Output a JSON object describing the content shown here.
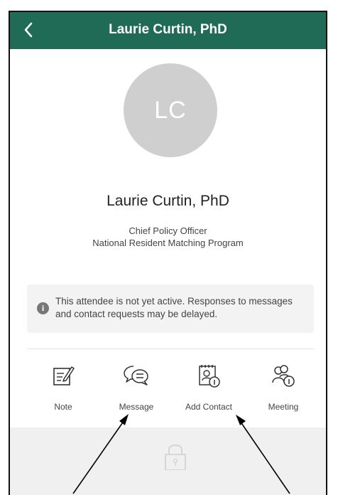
{
  "header": {
    "title": "Laurie Curtin, PhD",
    "back_icon": "chevron-left-icon",
    "color": "#1f6b56"
  },
  "profile": {
    "initials": "LC",
    "name": "Laurie Curtin, PhD",
    "position": "Chief Policy Officer",
    "organization": "National Resident Matching Program"
  },
  "notice": {
    "icon": "info-icon",
    "text": "This attendee is not yet active. Responses to messages and contact requests may be delayed."
  },
  "actions": [
    {
      "label": "Note",
      "icon": "note-icon"
    },
    {
      "label": "Message",
      "icon": "message-icon"
    },
    {
      "label": "Add Contact",
      "icon": "add-contact-icon"
    },
    {
      "label": "Meeting",
      "icon": "meeting-icon"
    }
  ],
  "locked_section": {
    "icon": "lock-icon"
  },
  "annotations": [
    {
      "target": "Message",
      "icon": "arrow-icon"
    },
    {
      "target": "Add Contact",
      "icon": "arrow-icon"
    }
  ]
}
